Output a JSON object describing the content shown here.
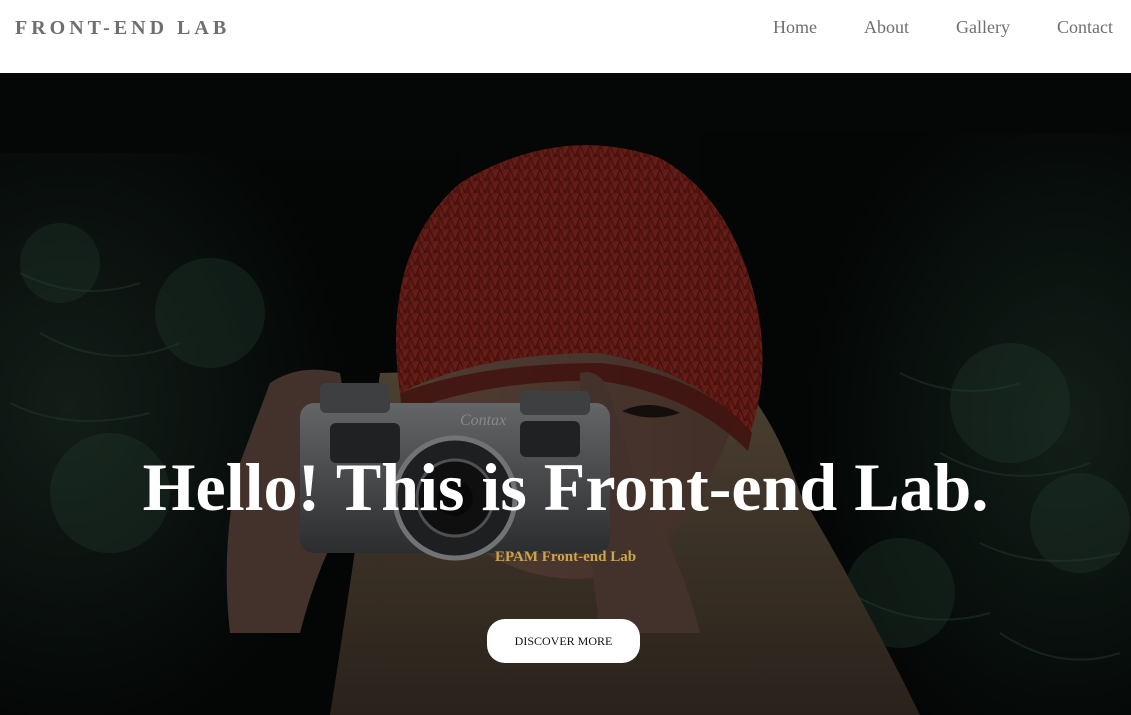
{
  "header": {
    "logo": "FRONT-END LAB",
    "nav": [
      {
        "label": "Home"
      },
      {
        "label": "About"
      },
      {
        "label": "Gallery"
      },
      {
        "label": "Contact"
      }
    ]
  },
  "hero": {
    "title": "Hello! This is Front-end Lab.",
    "subtitle": "EPAM Front-end Lab",
    "cta_label": "DISCOVER MORE",
    "camera_brand": "Contax"
  },
  "colors": {
    "header_bg": "#ffffff",
    "nav_text": "#6f6f6f",
    "hero_title": "#ffffff",
    "hero_subtitle": "#c9a64a",
    "button_bg": "#ffffff",
    "button_text": "#111111"
  }
}
